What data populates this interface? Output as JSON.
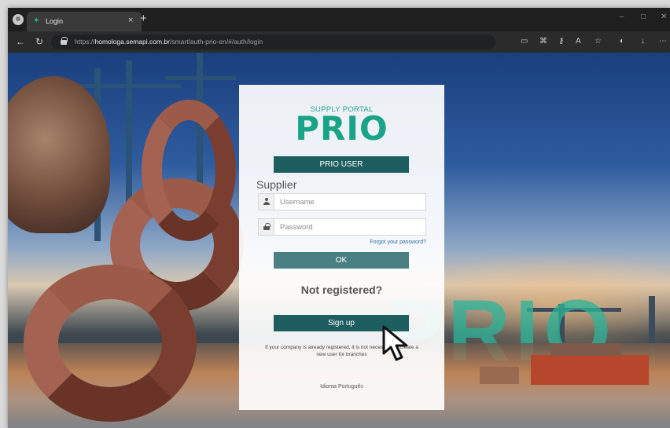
{
  "browser": {
    "tab_title": "Login",
    "tab_close": "×",
    "new_tab": "+",
    "url_scheme": "https://",
    "url_host": "homologa.semapi.com.br",
    "url_path": "/smart/auth-prio-en/#/auth/login",
    "window_minimize": "–",
    "window_maximize": "□",
    "window_close": "✕",
    "back_glyph": "←",
    "reload_glyph": "↻",
    "download_glyph": "↓",
    "menu_glyph": "⋯"
  },
  "icons": {
    "favicon": "leaf-icon",
    "user": "user-icon",
    "password": "lock-icon",
    "cursor": "pointer-arrow-icon"
  },
  "login": {
    "supply_portal": "SUPPLY PORTAL",
    "logo": "PRIO",
    "prio_user_button": "PRIO USER",
    "section_title": "Supplier",
    "username_placeholder": "Username",
    "password_placeholder": "Password",
    "forgot_password": "Forgot your password?",
    "ok_button": "OK",
    "not_registered": "Not registered?",
    "signup_button": "Sign up",
    "note": "If your company is already registered, it is not necessary to create a new user for branches",
    "language": "Idioma Português"
  },
  "background": {
    "watermark_word": "PRIO"
  },
  "colors": {
    "brand_green": "#1aa487",
    "button_teal": "#1e5e60",
    "button_muted": "#4b8082"
  }
}
